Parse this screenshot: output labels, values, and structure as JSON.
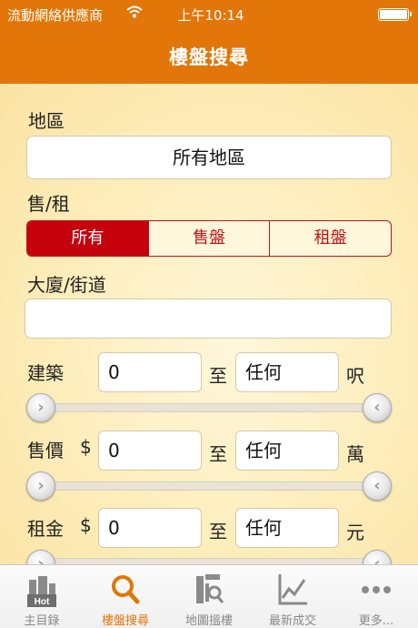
{
  "status_bar": {
    "carrier": "流動網絡供應商",
    "time": "上午10:14"
  },
  "nav": {
    "title": "樓盤搜尋"
  },
  "form": {
    "region_label": "地區",
    "region_value": "所有地區",
    "type_label": "售/租",
    "type_options": [
      "所有",
      "售盤",
      "租盤"
    ],
    "type_selected": "所有",
    "street_label": "大廈/街道",
    "street_value": "",
    "area": {
      "label": "建築",
      "min": "0",
      "to": "至",
      "max": "任何",
      "unit": "呎"
    },
    "price": {
      "label": "售價",
      "currency": "$",
      "min": "0",
      "to": "至",
      "max": "任何",
      "unit": "萬"
    },
    "rent": {
      "label": "租金",
      "currency": "$",
      "min": "0",
      "to": "至",
      "max": "任何",
      "unit": "元"
    }
  },
  "tabs": [
    {
      "label": "主目錄",
      "icon": "hot-buildings-icon",
      "active": false
    },
    {
      "label": "樓盤搜尋",
      "icon": "search-icon",
      "active": true
    },
    {
      "label": "地圖搵樓",
      "icon": "map-search-icon",
      "active": false
    },
    {
      "label": "最新成交",
      "icon": "line-chart-icon",
      "active": false
    },
    {
      "label": "更多...",
      "icon": "more-icon",
      "active": false
    }
  ],
  "colors": {
    "brand": "#e27608",
    "accent_red": "#c4010c",
    "background": "#fdf0c4"
  }
}
